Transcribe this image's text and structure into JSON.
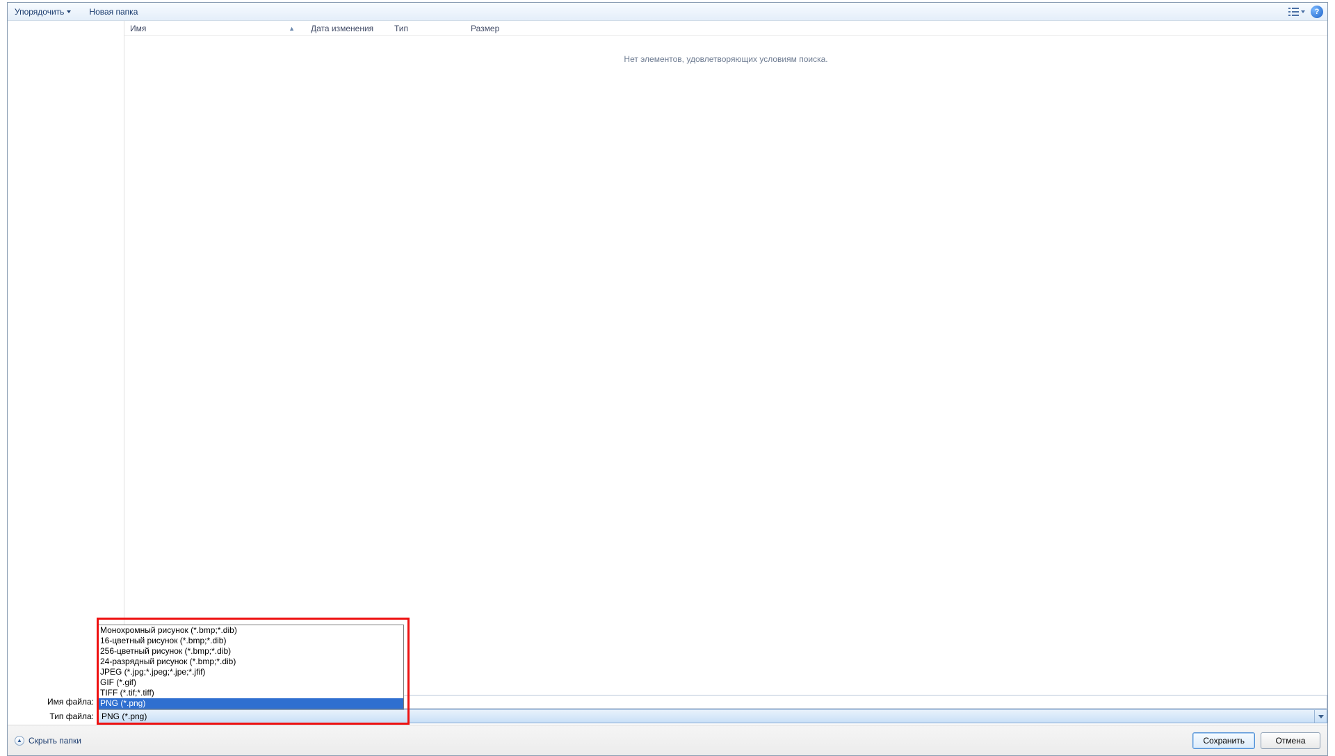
{
  "toolbar": {
    "organize_label": "Упорядочить",
    "new_folder_label": "Новая папка"
  },
  "columns": {
    "name": "Имя",
    "date": "Дата изменения",
    "type": "Тип",
    "size": "Размер"
  },
  "empty_message": "Нет элементов, удовлетворяющих условиям поиска.",
  "file_name_label": "Имя файла:",
  "file_type_label": "Тип файла:",
  "file_type_selected": "PNG (*.png)",
  "file_type_options": [
    "Монохромный рисунок (*.bmp;*.dib)",
    "16-цветный рисунок (*.bmp;*.dib)",
    "256-цветный рисунок (*.bmp;*.dib)",
    "24-разрядный рисунок (*.bmp;*.dib)",
    "JPEG (*.jpg;*.jpeg;*.jpe;*.jfif)",
    "GIF (*.gif)",
    "TIFF (*.tif;*.tiff)",
    "PNG (*.png)"
  ],
  "file_type_highlight_index": 7,
  "footer": {
    "hide_folders_label": "Скрыть папки",
    "save_label": "Сохранить",
    "cancel_label": "Отмена"
  },
  "help_glyph": "?"
}
